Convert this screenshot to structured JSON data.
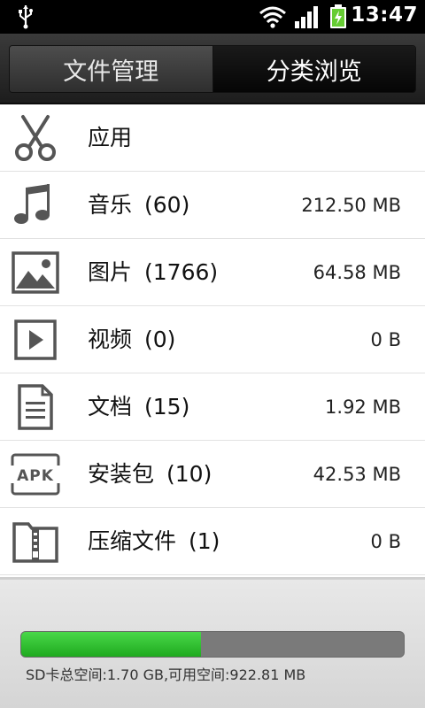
{
  "status": {
    "time": "13:47",
    "battery_fraction": 0.7
  },
  "tabs": [
    {
      "label": "文件管理"
    },
    {
      "label": "分类浏览"
    }
  ],
  "categories": [
    {
      "name": "应用",
      "count": "",
      "size": "",
      "icon": "scissors-icon"
    },
    {
      "name": "音乐",
      "count": "(60)",
      "size": "212.50 MB",
      "icon": "music-note-icon"
    },
    {
      "name": "图片",
      "count": "(1766)",
      "size": "64.58 MB",
      "icon": "picture-icon"
    },
    {
      "name": "视频",
      "count": "(0)",
      "size": "0 B",
      "icon": "video-play-icon"
    },
    {
      "name": "文档",
      "count": "(15)",
      "size": "1.92 MB",
      "icon": "document-icon"
    },
    {
      "name": "安装包",
      "count": "(10)",
      "size": "42.53 MB",
      "icon": "apk-icon"
    },
    {
      "name": "压缩文件",
      "count": "(1)",
      "size": "0 B",
      "icon": "zip-folder-icon"
    }
  ],
  "storage": {
    "text": "SD卡总空间:1.70 GB,可用空间:922.81 MB",
    "used_fraction": 0.47,
    "colors": {
      "used": "#2fc22f",
      "free": "#7a7a7a"
    }
  }
}
